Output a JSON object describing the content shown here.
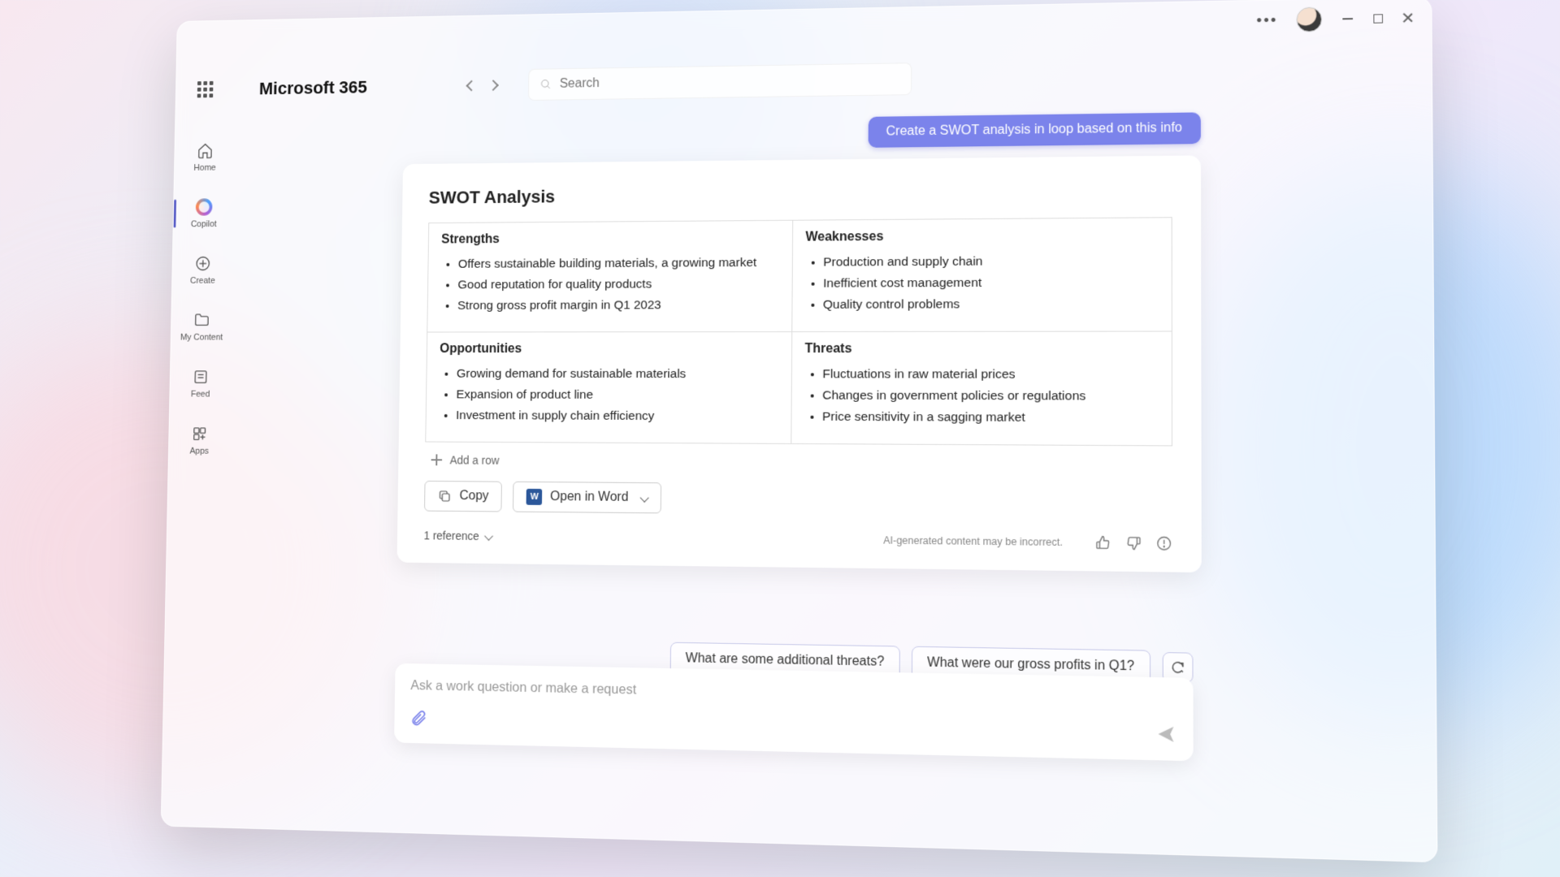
{
  "window": {
    "brand": "Microsoft 365",
    "search_placeholder": "Search"
  },
  "rail": [
    {
      "id": "home",
      "label": "Home"
    },
    {
      "id": "copilot",
      "label": "Copilot"
    },
    {
      "id": "create",
      "label": "Create"
    },
    {
      "id": "mycontent",
      "label": "My Content"
    },
    {
      "id": "feed",
      "label": "Feed"
    },
    {
      "id": "apps",
      "label": "Apps"
    }
  ],
  "chat": {
    "user_message": "Create a SWOT analysis in loop based on this info",
    "response_title": "SWOT Analysis",
    "swot": {
      "strengths": {
        "heading": "Strengths",
        "items": [
          "Offers sustainable building materials, a growing market",
          "Good reputation for quality products",
          "Strong gross profit margin in Q1 2023"
        ]
      },
      "weaknesses": {
        "heading": "Weaknesses",
        "items": [
          "Production and supply chain",
          "Inefficient cost management",
          "Quality control problems"
        ]
      },
      "opportunities": {
        "heading": "Opportunities",
        "items": [
          "Growing demand for sustainable materials",
          "Expansion of product line",
          "Investment in supply chain efficiency"
        ]
      },
      "threats": {
        "heading": "Threats",
        "items": [
          "Fluctuations in raw material prices",
          "Changes in government policies or regulations",
          "Price sensitivity in a sagging market"
        ]
      }
    },
    "add_row": "Add a row",
    "copy_btn": "Copy",
    "open_word_btn": "Open in Word",
    "references": "1 reference",
    "disclaimer": "AI-generated content may be incorrect.",
    "suggestions": [
      "What are some additional threats?",
      "What were our gross profits in Q1?"
    ],
    "composer_placeholder": "Ask a work question or make a request"
  }
}
